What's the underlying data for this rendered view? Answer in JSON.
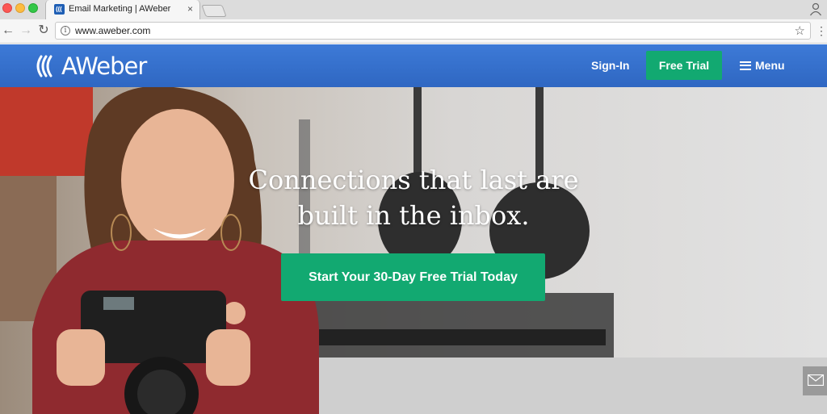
{
  "browser": {
    "tab_title": "Email Marketing | AWeber",
    "tab_close": "×",
    "url": "www.aweber.com",
    "icons": [
      "back-arrow-icon",
      "forward-arrow-icon",
      "reload-icon",
      "info-icon",
      "star-icon",
      "kebab-menu-icon",
      "profile-icon"
    ]
  },
  "header": {
    "logo_text": "AWeber",
    "signin_label": "Sign-In",
    "free_trial_label": "Free Trial",
    "menu_label": "Menu"
  },
  "hero": {
    "heading_line1": "Connections that last are",
    "heading_line2": "built in the inbox.",
    "cta_label": "Start Your 30-Day Free Trial Today"
  },
  "colors": {
    "header_blue": "#3270cb",
    "cta_green": "#12a971"
  }
}
